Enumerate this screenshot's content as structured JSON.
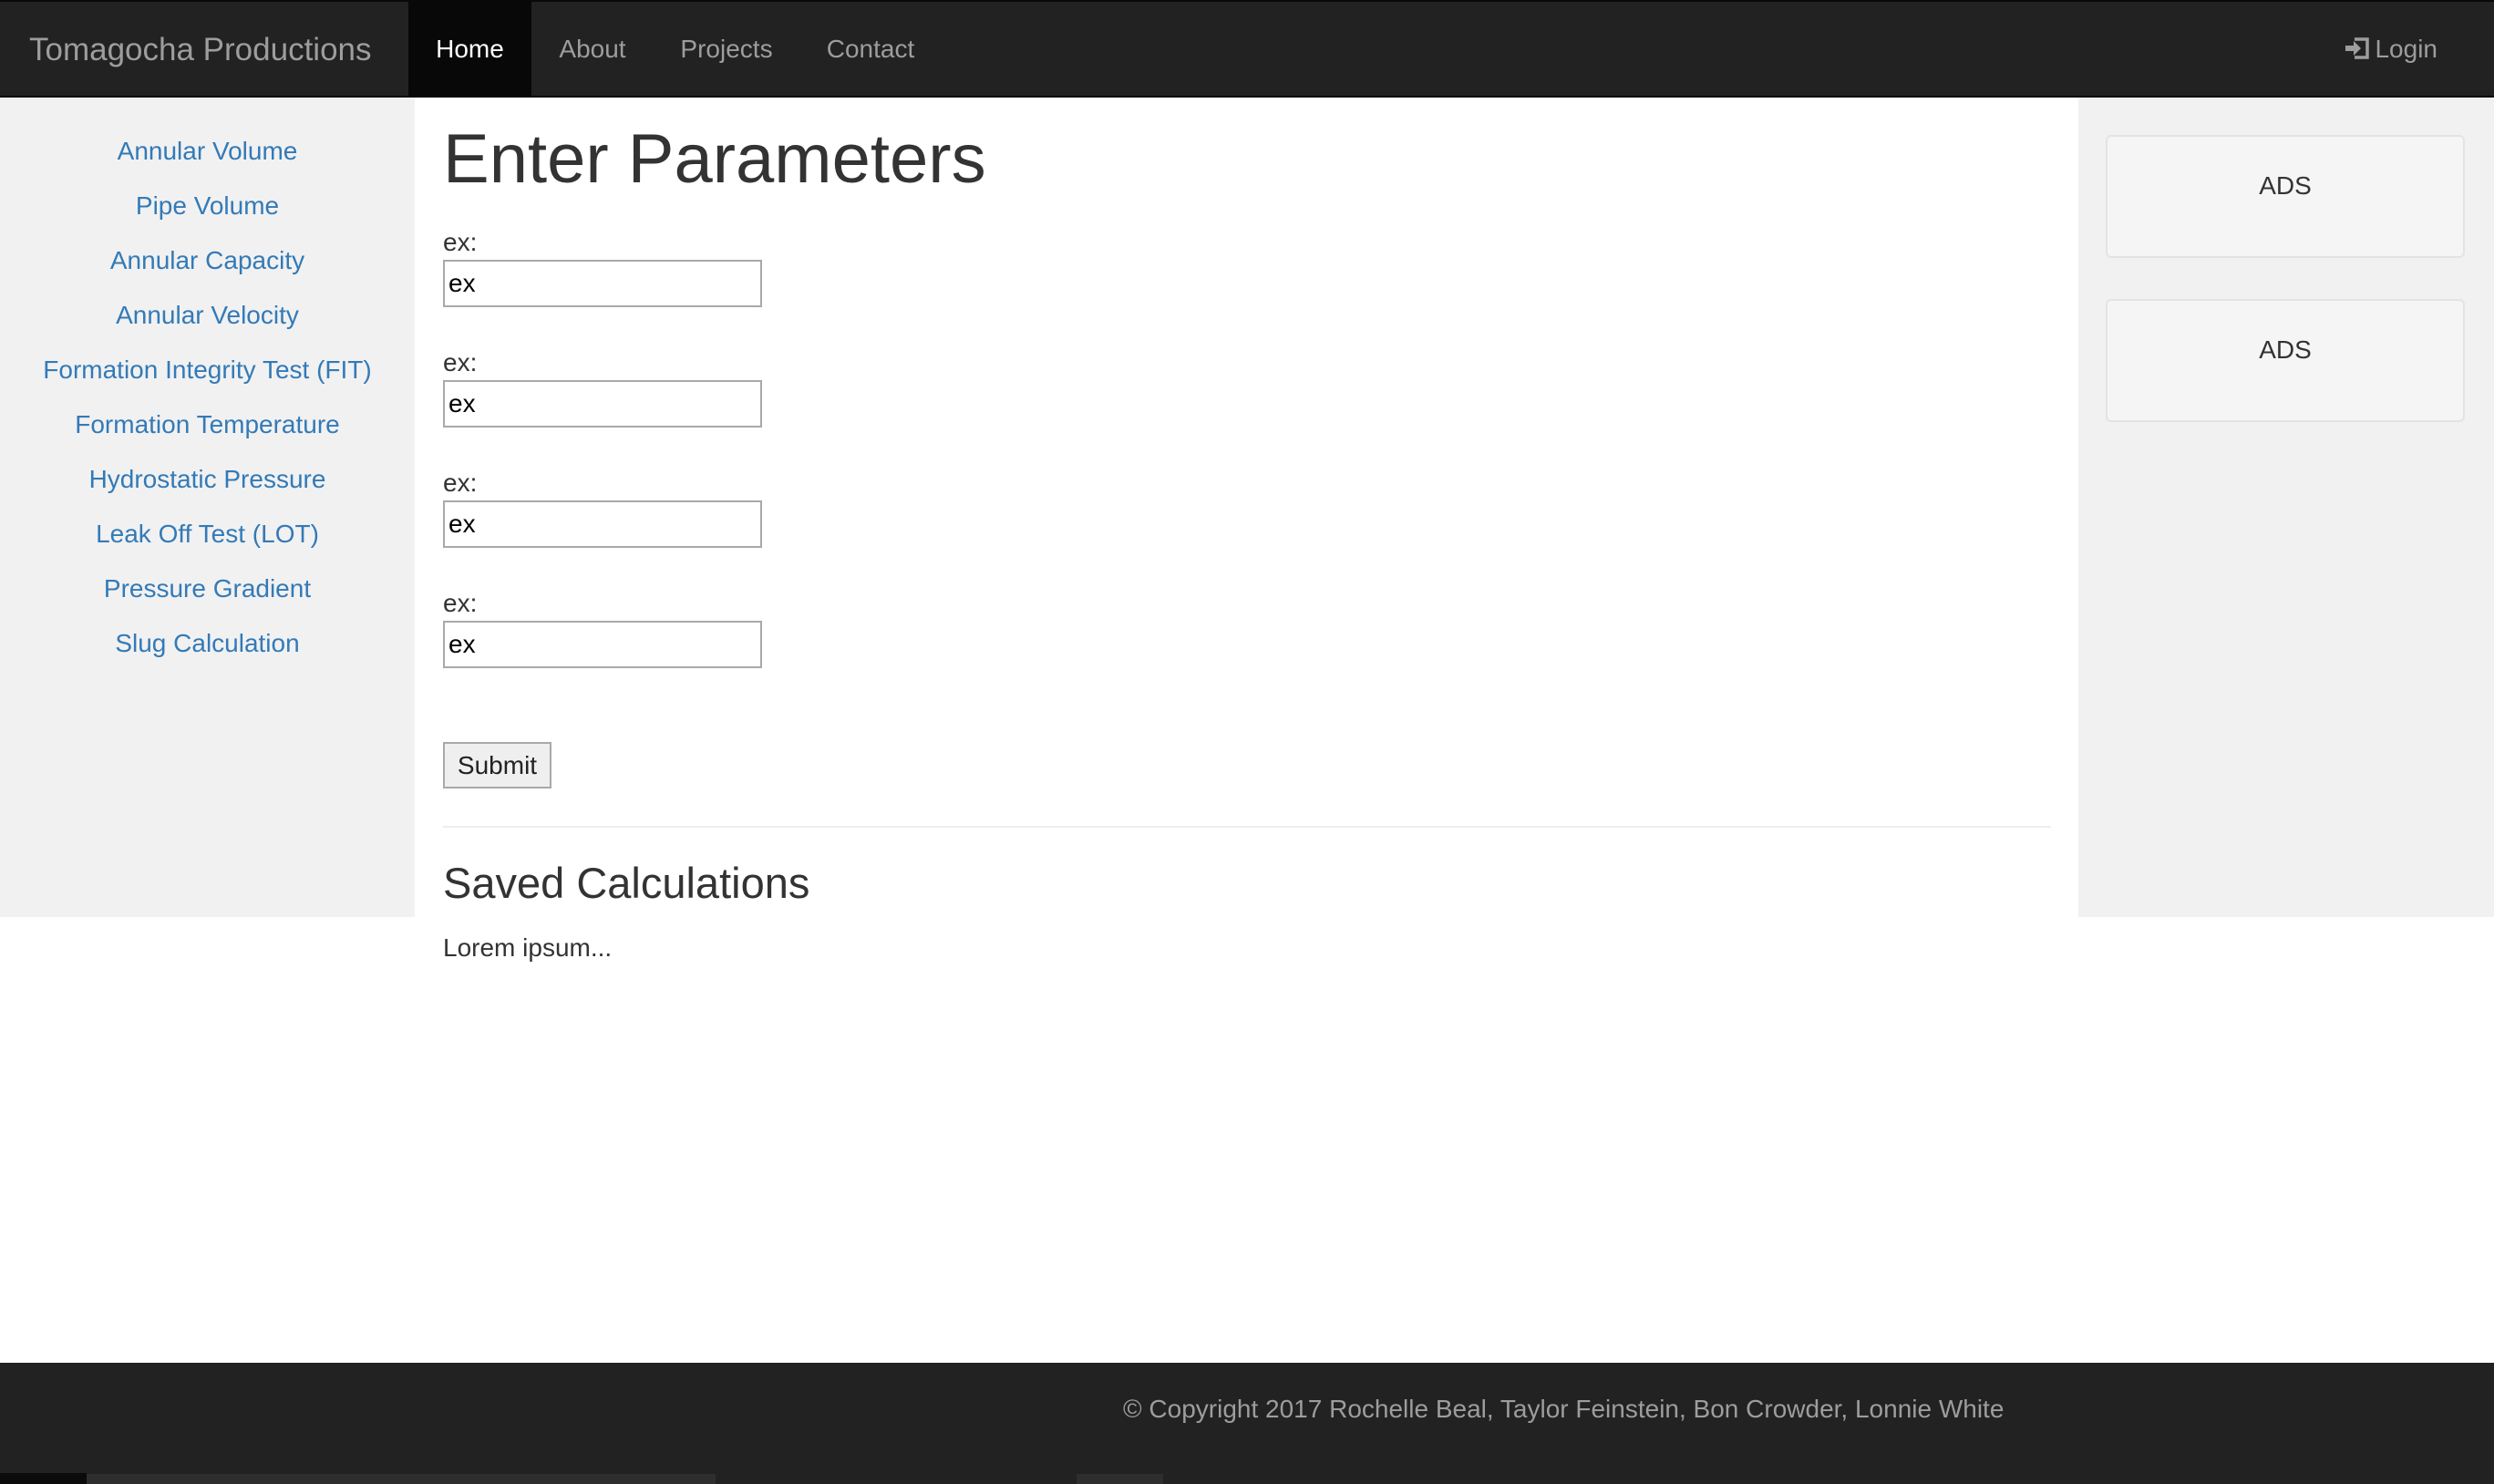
{
  "navbar": {
    "brand": "Tomagocha Productions",
    "items": [
      {
        "label": "Home",
        "active": true
      },
      {
        "label": "About",
        "active": false
      },
      {
        "label": "Projects",
        "active": false
      },
      {
        "label": "Contact",
        "active": false
      }
    ],
    "login_label": "Login",
    "login_icon": "log-in-icon"
  },
  "sidebar": {
    "links": [
      "Annular Volume",
      "Pipe Volume",
      "Annular Capacity",
      "Annular Velocity",
      "Formation Integrity Test (FIT)",
      "Formation Temperature",
      "Hydrostatic Pressure",
      "Leak Off Test (LOT)",
      "Pressure Gradient",
      "Slug Calculation"
    ]
  },
  "main": {
    "title": "Enter Parameters",
    "fields": [
      {
        "label": "ex:",
        "value": "ex"
      },
      {
        "label": "ex:",
        "value": "ex"
      },
      {
        "label": "ex:",
        "value": "ex"
      },
      {
        "label": "ex:",
        "value": "ex"
      }
    ],
    "submit_label": "Submit",
    "saved_title": "Saved Calculations",
    "saved_text": "Lorem ipsum..."
  },
  "ads": [
    "ADS",
    "ADS"
  ],
  "footer": {
    "copyright": "© Copyright 2017 Rochelle Beal, Taylor Feinstein, Bon Crowder, Lonnie White"
  },
  "colors": {
    "navbar_bg": "#222222",
    "nav_active_bg": "#080808",
    "link_blue": "#337ab7",
    "sidebar_bg": "#f1f1f1"
  }
}
